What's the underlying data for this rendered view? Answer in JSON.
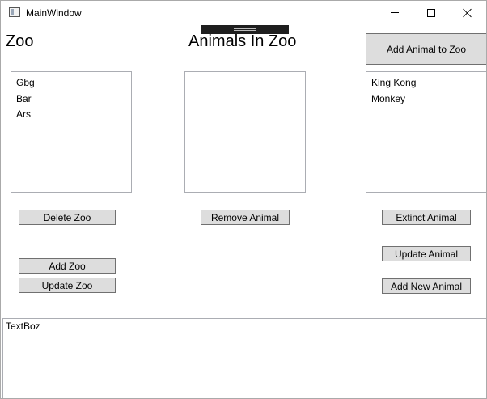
{
  "window": {
    "title": "MainWindow",
    "controls": {
      "minimize": "minimize-icon",
      "maximize": "maximize-icon",
      "close": "close-icon"
    }
  },
  "headings": {
    "zoo": "Zoo",
    "animals_in_zoo": "Animals In Zoo"
  },
  "buttons": {
    "add_animal_to_zoo": "Add Animal to Zoo",
    "delete_zoo": "Delete Zoo",
    "remove_animal": "Remove Animal",
    "extinct_animal": "Extinct Animal",
    "add_zoo": "Add Zoo",
    "update_zoo": "Update Zoo",
    "update_animal": "Update Animal",
    "add_new_animal": "Add New Animal"
  },
  "lists": {
    "zoos": [
      "Gbg",
      "Bar",
      "Ars"
    ],
    "animals_in_zoo": [],
    "animals": [
      "King Kong",
      "Monkey"
    ]
  },
  "textbox": {
    "value": "TextBoz"
  }
}
